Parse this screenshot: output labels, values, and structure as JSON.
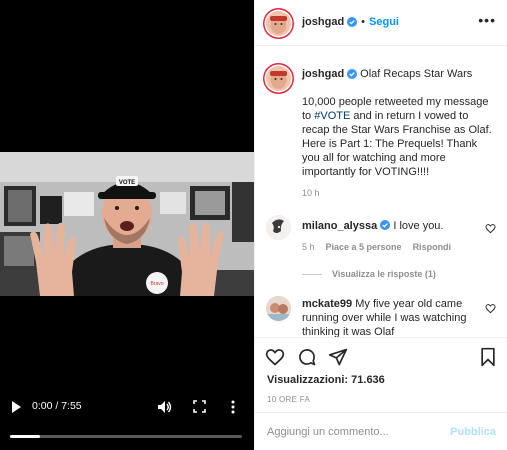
{
  "video": {
    "time": "0:00 / 7:55",
    "progress_fraction": 0.13,
    "shirt_text": "Bravo",
    "cap_text": "VOTE"
  },
  "header": {
    "username": "joshgad",
    "separator": "•",
    "follow_label": "Segui",
    "more_icon": "more-horizontal-icon"
  },
  "caption": {
    "username": "joshgad",
    "title": "Olaf Recaps Star Wars",
    "text_before": "10,000 people retweeted my message to ",
    "hashtag": "#VOTE",
    "text_after": " and in return I vowed to recap the Star Wars Franchise as Olaf. Here is Part 1: The Prequels! Thank you all for watching and more importantly for VOTING!!!!",
    "time": "10 h"
  },
  "comments": [
    {
      "username": "milano_alyssa",
      "verified": true,
      "text": "I love you.",
      "time": "5 h",
      "likes": "Piace a 5 persone",
      "reply_label": "Rispondi",
      "view_replies": "Visualizza le risposte (1)"
    },
    {
      "username": "mckate99",
      "verified": false,
      "text": "My five year old came running over while I was watching thinking it was Olaf"
    }
  ],
  "stats": {
    "views": "Visualizzazioni: 71.636",
    "date": "10 ORE FA"
  },
  "add_comment": {
    "placeholder": "Aggiungi un commento...",
    "publish_label": "Pubblica"
  },
  "colors": {
    "accent": "#0095f6",
    "verified": "#3897f0",
    "hashtag": "#00376b",
    "muted": "#8e8e8e",
    "publish_disabled": "#b2dffc"
  }
}
